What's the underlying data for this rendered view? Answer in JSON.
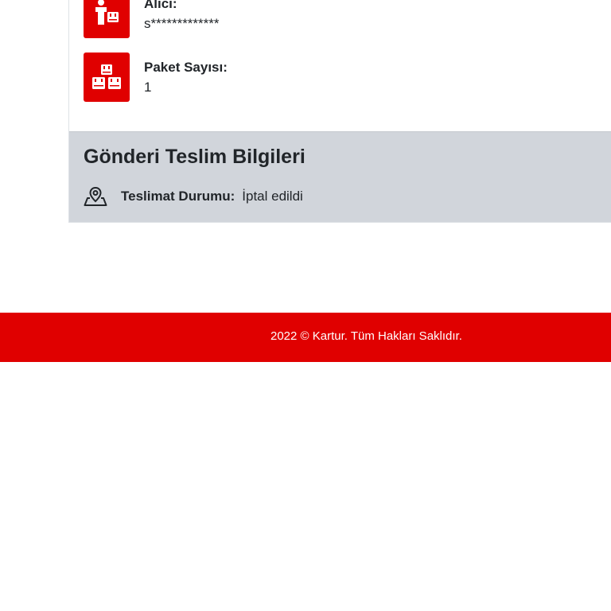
{
  "shipment": {
    "recipient": {
      "label": "Alıcı:",
      "value": "s*************",
      "icon": "recipient-package-icon"
    },
    "package_count": {
      "label": "Paket Sayısı:",
      "value": "1",
      "icon": "packages-icon"
    }
  },
  "delivery_info": {
    "title": "Gönderi Teslim Bilgileri",
    "status_label": "Teslimat Durumu:",
    "status_value": "İptal edildi",
    "status_icon": "map-pin-icon"
  },
  "footer": {
    "text": "2022 © Kartur. Tüm Hakları Saklıdır."
  },
  "colors": {
    "brand_red": "#e00000",
    "section_gray": "#d1d5db",
    "text_dark": "#212529"
  }
}
